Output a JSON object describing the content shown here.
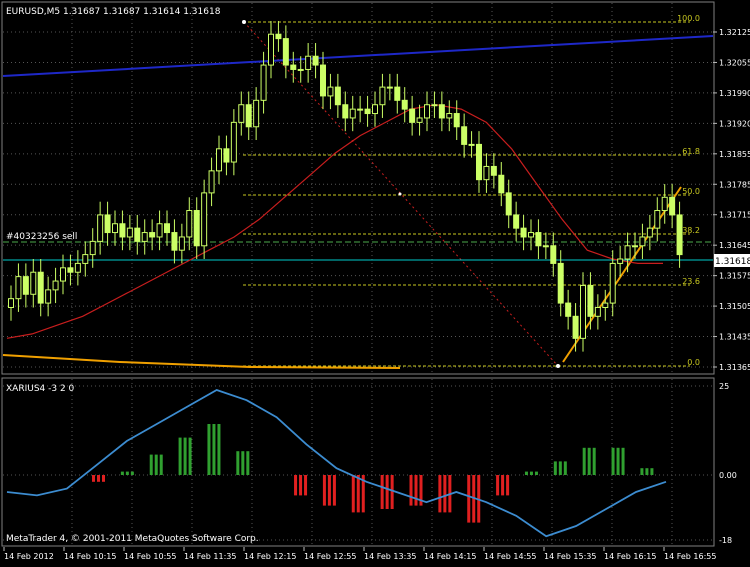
{
  "window": {
    "symbol_header": "EURUSD,M5  1.31687 1.31687 1.31614 1.31618",
    "copyright": "MetaTrader 4, © 2001-2011 MetaQuotes Software Corp."
  },
  "price_panel": {
    "price_labels": [
      "1.32125",
      "1.32055",
      "1.31990",
      "1.31920",
      "1.31855",
      "1.31785",
      "1.31715",
      "1.31645",
      "1.31575",
      "1.31505",
      "1.31435",
      "1.31365"
    ],
    "current_price": "1.31618",
    "order_label": "#40323256 sell",
    "fib_labels": [
      "100.0",
      "61.8",
      "50.0",
      "38.2",
      "23.6",
      "0.0"
    ]
  },
  "indicator_panel": {
    "name": "XARIUS4 -3 2 0",
    "scale_labels": [
      "25",
      "0.00",
      "-18"
    ]
  },
  "time_axis": {
    "labels": [
      "14 Feb 2012",
      "14 Feb 10:15",
      "14 Feb 10:55",
      "14 Feb 11:35",
      "14 Feb 12:15",
      "14 Feb 12:55",
      "14 Feb 13:35",
      "14 Feb 14:15",
      "14 Feb 14:55",
      "14 Feb 15:35",
      "14 Feb 16:15",
      "14 Feb 16:55"
    ]
  },
  "colors": {
    "background": "#000000",
    "candle_body": "#ccff66",
    "grid_dotted": "#555555",
    "fib_line": "#c8c820",
    "ma_line": "#c81e1e",
    "trendline_blue": "#1e28c8",
    "trendline_orange": "#f0a000",
    "histogram_up": "#30a030",
    "histogram_down": "#e02020",
    "oscillator_line": "#3c8cd0",
    "order_line": "#4caa4c",
    "current_price_line": "#00cccc"
  },
  "chart_data": {
    "type": "candlestick",
    "price_scale_range": [
      1.31365,
      1.32125
    ],
    "closes": [
      1.3152,
      1.3157,
      1.3153,
      1.3158,
      1.3151,
      1.3154,
      1.3156,
      1.3159,
      1.3158,
      1.316,
      1.3162,
      1.3165,
      1.3171,
      1.3167,
      1.3169,
      1.3166,
      1.3168,
      1.3165,
      1.3167,
      1.3166,
      1.3169,
      1.3167,
      1.3163,
      1.3166,
      1.3172,
      1.3164,
      1.3176,
      1.3181,
      1.3186,
      1.3183,
      1.3192,
      1.3196,
      1.3191,
      1.3197,
      1.3205,
      1.3212,
      1.3211,
      1.3205,
      1.3204,
      1.3204,
      1.3207,
      1.3205,
      1.3198,
      1.32,
      1.3196,
      1.3193,
      1.3195,
      1.3195,
      1.3194,
      1.3196,
      1.32,
      1.32,
      1.3197,
      1.3195,
      1.3192,
      1.3193,
      1.3196,
      1.3196,
      1.3193,
      1.3194,
      1.3191,
      1.3187,
      1.3187,
      1.3179,
      1.3182,
      1.318,
      1.3176,
      1.3171,
      1.3168,
      1.3166,
      1.3167,
      1.3164,
      1.3164,
      1.316,
      1.3151,
      1.3148,
      1.3143,
      1.3155,
      1.3148,
      1.315,
      1.3151,
      1.316,
      1.3161,
      1.3164,
      1.3164,
      1.3166,
      1.3168,
      1.3172,
      1.3175,
      1.3171,
      1.3162
    ],
    "moving_average": [
      1.3143,
      1.3144,
      1.3146,
      1.3148,
      1.3151,
      1.3154,
      1.3157,
      1.316,
      1.3163,
      1.3166,
      1.317,
      1.3175,
      1.318,
      1.3185,
      1.3189,
      1.3192,
      1.3195,
      1.3196,
      1.3195,
      1.3192,
      1.3186,
      1.3178,
      1.317,
      1.3163,
      1.3161,
      1.316,
      1.316
    ],
    "oscillator_line": [
      -5,
      -6,
      -4,
      3,
      10,
      15,
      20,
      25,
      22,
      17,
      9,
      2,
      -2,
      -5,
      -8,
      -5,
      -8,
      -12,
      -18,
      -15,
      -10,
      -5,
      -2
    ],
    "histogram": [
      -2,
      1,
      6,
      11,
      15,
      7,
      0,
      -6,
      -9,
      -11,
      -10,
      -9,
      -11,
      -14,
      -6,
      1,
      4,
      8,
      8,
      2
    ]
  }
}
